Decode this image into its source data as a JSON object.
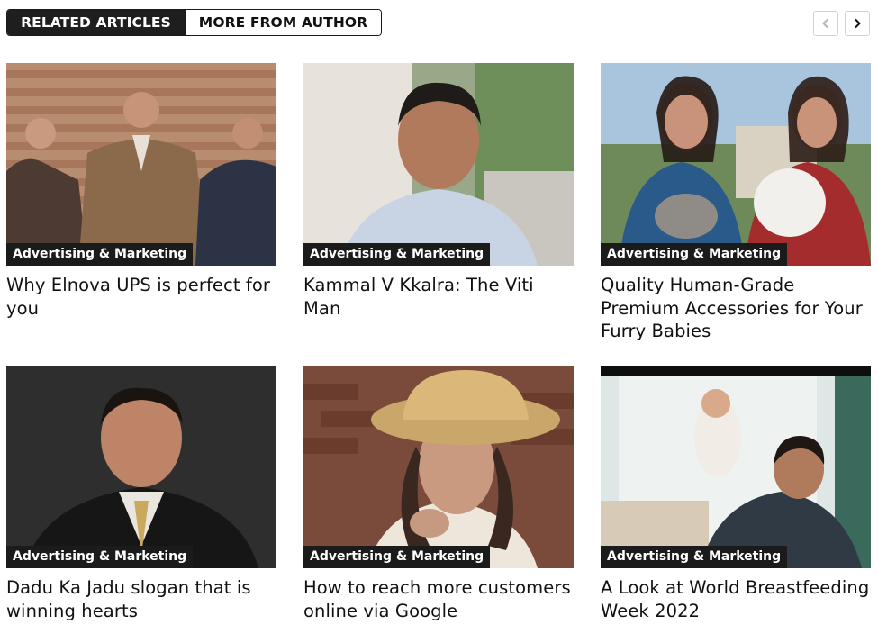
{
  "tabs": [
    {
      "label": "RELATED ARTICLES",
      "active": true
    },
    {
      "label": "MORE FROM AUTHOR",
      "active": false
    }
  ],
  "nav": {
    "prev_icon": "chevron-left-icon",
    "next_icon": "chevron-right-icon"
  },
  "articles": [
    {
      "category": "Advertising & Marketing",
      "title": "Why Elnova UPS is perfect for you",
      "image": "three-men-standing-photo"
    },
    {
      "category": "Advertising & Marketing",
      "title": "Kammal V Kkalra: The Viti Man",
      "image": "man-portrait-photo"
    },
    {
      "category": "Advertising & Marketing",
      "title": "Quality Human-Grade Premium Accessories for Your Furry Babies",
      "image": "women-with-dogs-photo"
    },
    {
      "category": "Advertising & Marketing",
      "title": "Dadu Ka Jadu slogan that is winning hearts",
      "image": "man-in-suit-photo"
    },
    {
      "category": "Advertising & Marketing",
      "title": "How to reach more customers online via Google",
      "image": "woman-in-hat-photo"
    },
    {
      "category": "Advertising & Marketing",
      "title": "A Look at World Breastfeeding Week 2022",
      "image": "father-lifting-baby-photo"
    }
  ],
  "colors": {
    "tab_active_bg": "#1e1e1e",
    "category_badge_bg": "#1b1b1b"
  }
}
